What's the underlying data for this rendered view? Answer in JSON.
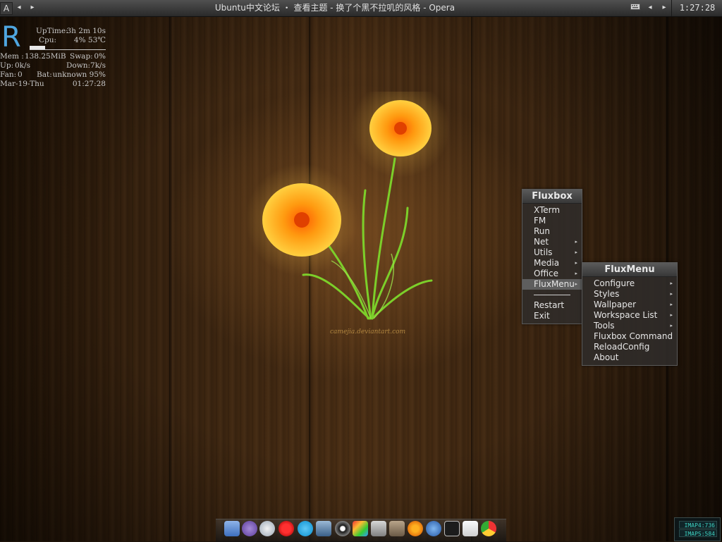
{
  "topbar": {
    "workspace_button": "A",
    "prev_label": "◂",
    "next_label": "▸",
    "window_title": "Ubuntu中文论坛 ・ 查看主题 - 换了个黑不拉叽的风格 - Opera",
    "clock": "1:27:28"
  },
  "conky": {
    "logo_letter": "R",
    "uptime_label": "UpTime:",
    "uptime_value": "3h 2m 10s",
    "cpu_label": "Cpu:",
    "cpu_value": "4%  53℃",
    "cpu_graph_level": 0.2,
    "mem_label": "Mem :",
    "mem_value": "138.25MiB",
    "swap_label": "Swap:",
    "swap_value": "0%",
    "up_label": "Up:",
    "up_value": "0k/s",
    "down_label": "Down:",
    "down_value": "7k/s",
    "fan_label": "Fan:",
    "fan_value": "0",
    "bat_label": "Bat:",
    "bat_value": "unknown 95%",
    "date": "Mar-19-Thu",
    "time": "01:27:28"
  },
  "wallpaper": {
    "signature": "camejia.deviantart.com"
  },
  "fluxbox_menu": {
    "title": "Fluxbox",
    "items": [
      {
        "label": "XTerm",
        "submenu": false
      },
      {
        "label": "FM",
        "submenu": false
      },
      {
        "label": "Run",
        "submenu": false
      },
      {
        "label": "Net",
        "submenu": true
      },
      {
        "label": "Utils",
        "submenu": true
      },
      {
        "label": "Media",
        "submenu": true
      },
      {
        "label": "Office",
        "submenu": true
      },
      {
        "label": "FluxMenu",
        "submenu": true
      },
      {
        "label": "Restart",
        "submenu": false
      },
      {
        "label": "Exit",
        "submenu": false
      }
    ]
  },
  "fluxmenu_menu": {
    "title": "FluxMenu",
    "items": [
      {
        "label": "Configure",
        "submenu": true
      },
      {
        "label": "Styles",
        "submenu": true
      },
      {
        "label": "Wallpaper",
        "submenu": true
      },
      {
        "label": "Workspace List",
        "submenu": true
      },
      {
        "label": "Tools",
        "submenu": true
      },
      {
        "label": "Fluxbox Command",
        "submenu": false
      },
      {
        "label": "ReloadConfig",
        "submenu": false
      },
      {
        "label": "About",
        "submenu": false
      }
    ]
  },
  "dock": {
    "icons": [
      "folder-icon",
      "emacs-icon",
      "pidgin-icon",
      "opera-icon",
      "skype-icon",
      "network-icon",
      "media-player-icon",
      "color-icon",
      "tools-icon",
      "gimp-icon",
      "firefox-icon",
      "thunderbird-icon",
      "terminal-icon",
      "text-editor-icon",
      "chrome-icon"
    ]
  },
  "tray": {
    "line1": "IMAP4:736",
    "line2": "IMAPS:584"
  },
  "colors": {
    "conky_accent": "#4fa6e0",
    "menu_bg": "#302c2a",
    "flower_orange": "#ff8a1a"
  }
}
